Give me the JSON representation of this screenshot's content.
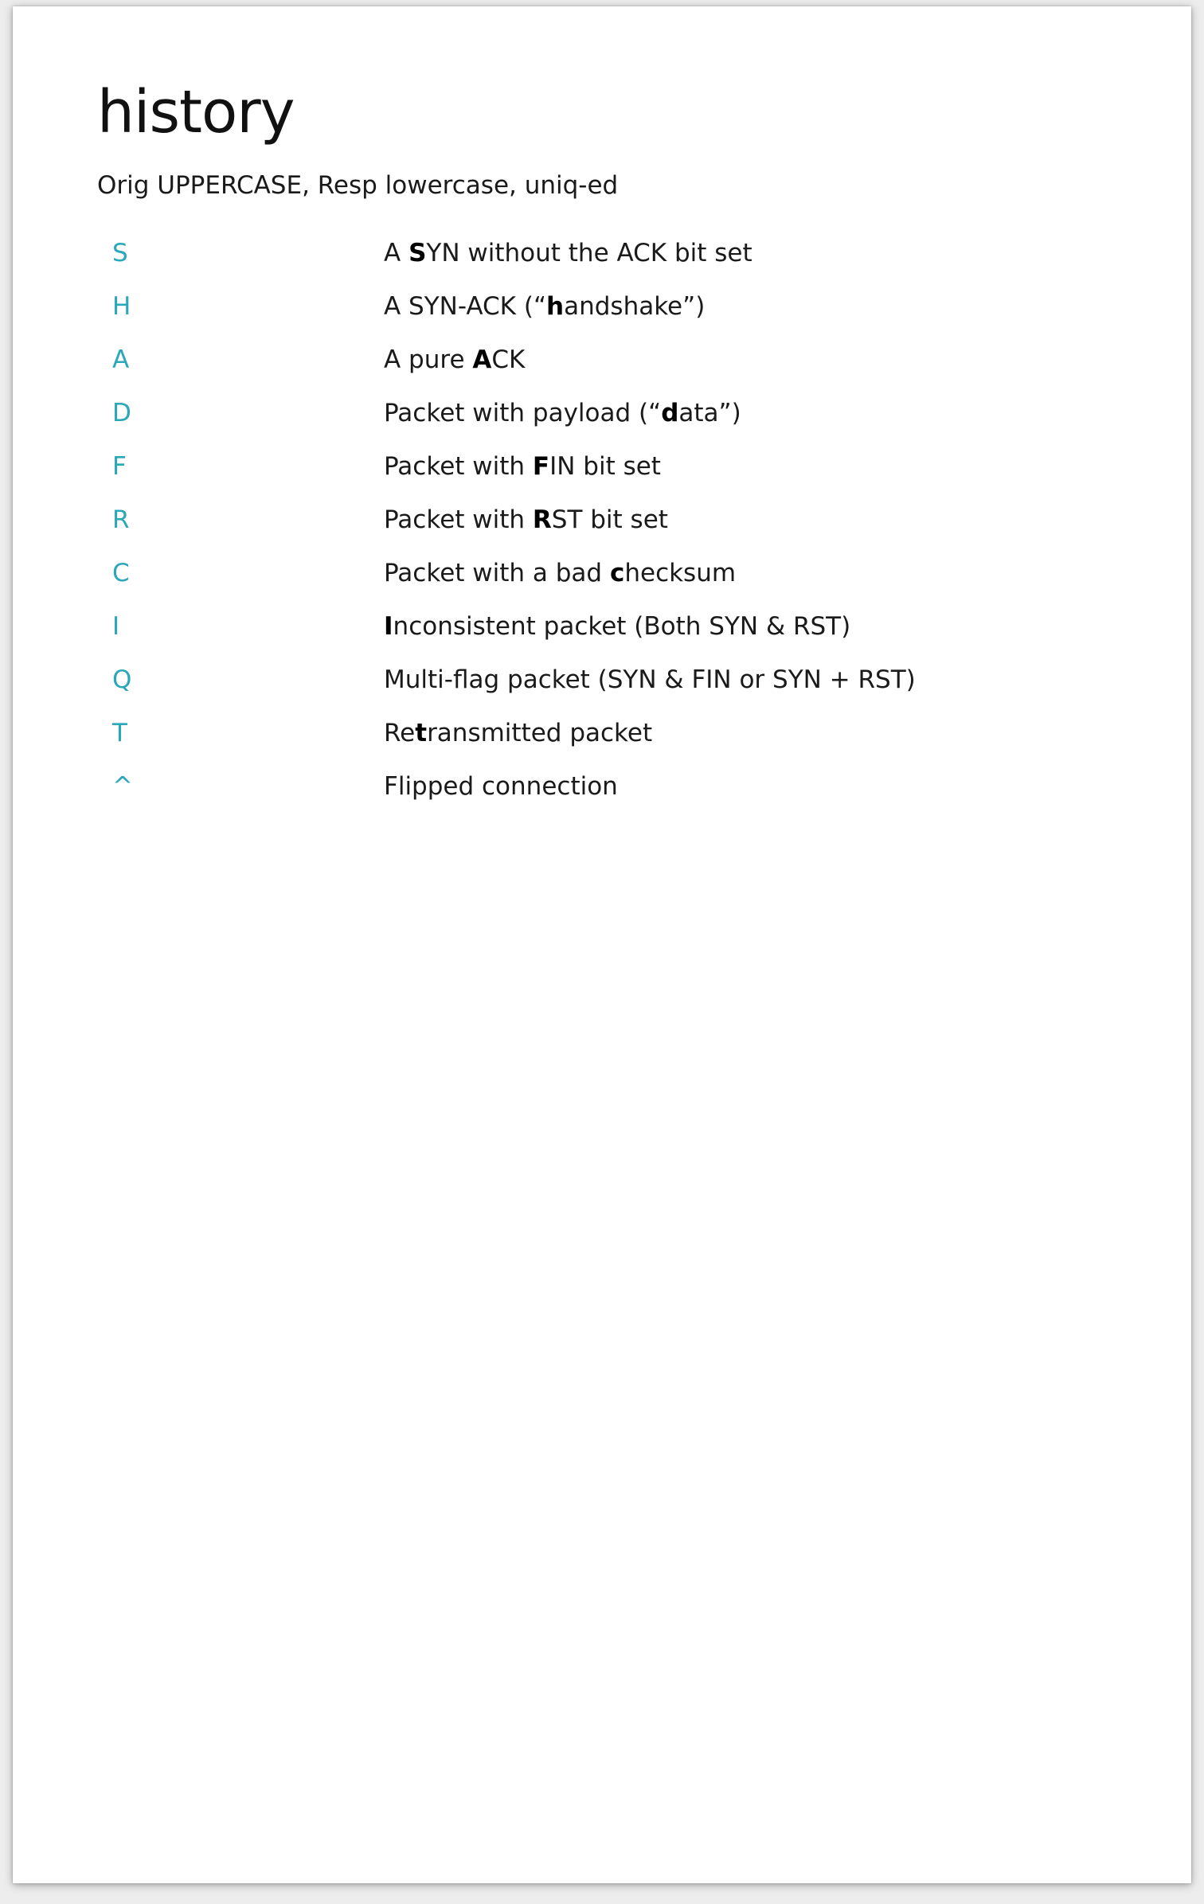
{
  "title": "history",
  "subtitle": "Orig UPPERCASE, Resp lowercase, uniq-ed",
  "accent_color": "#2aa7b8",
  "rows": [
    {
      "code": "S",
      "segments": [
        {
          "text": "A ",
          "bold": false
        },
        {
          "text": "S",
          "bold": true
        },
        {
          "text": "YN without the ACK bit set",
          "bold": false
        }
      ]
    },
    {
      "code": "H",
      "segments": [
        {
          "text": "A SYN-ACK (“",
          "bold": false
        },
        {
          "text": "h",
          "bold": true
        },
        {
          "text": "andshake”)",
          "bold": false
        }
      ]
    },
    {
      "code": "A",
      "segments": [
        {
          "text": "A pure ",
          "bold": false
        },
        {
          "text": "A",
          "bold": true
        },
        {
          "text": "CK",
          "bold": false
        }
      ]
    },
    {
      "code": "D",
      "segments": [
        {
          "text": "Packet with payload (“",
          "bold": false
        },
        {
          "text": "d",
          "bold": true
        },
        {
          "text": "ata”)",
          "bold": false
        }
      ]
    },
    {
      "code": "F",
      "segments": [
        {
          "text": "Packet with ",
          "bold": false
        },
        {
          "text": "F",
          "bold": true
        },
        {
          "text": "IN bit set",
          "bold": false
        }
      ]
    },
    {
      "code": "R",
      "segments": [
        {
          "text": "Packet with ",
          "bold": false
        },
        {
          "text": "R",
          "bold": true
        },
        {
          "text": "ST bit set",
          "bold": false
        }
      ]
    },
    {
      "code": "C",
      "segments": [
        {
          "text": "Packet with a bad ",
          "bold": false
        },
        {
          "text": "c",
          "bold": true
        },
        {
          "text": "hecksum",
          "bold": false
        }
      ]
    },
    {
      "code": "I",
      "segments": [
        {
          "text": "I",
          "bold": true
        },
        {
          "text": "nconsistent packet (Both SYN & RST)",
          "bold": false
        }
      ]
    },
    {
      "code": "Q",
      "segments": [
        {
          "text": "Multi-flag packet (SYN & FIN or SYN + RST)",
          "bold": false
        }
      ]
    },
    {
      "code": "T",
      "segments": [
        {
          "text": "Re",
          "bold": false
        },
        {
          "text": "t",
          "bold": true
        },
        {
          "text": "ransmitted packet",
          "bold": false
        }
      ]
    },
    {
      "code": "^",
      "segments": [
        {
          "text": "Flipped connection",
          "bold": false
        }
      ]
    }
  ]
}
